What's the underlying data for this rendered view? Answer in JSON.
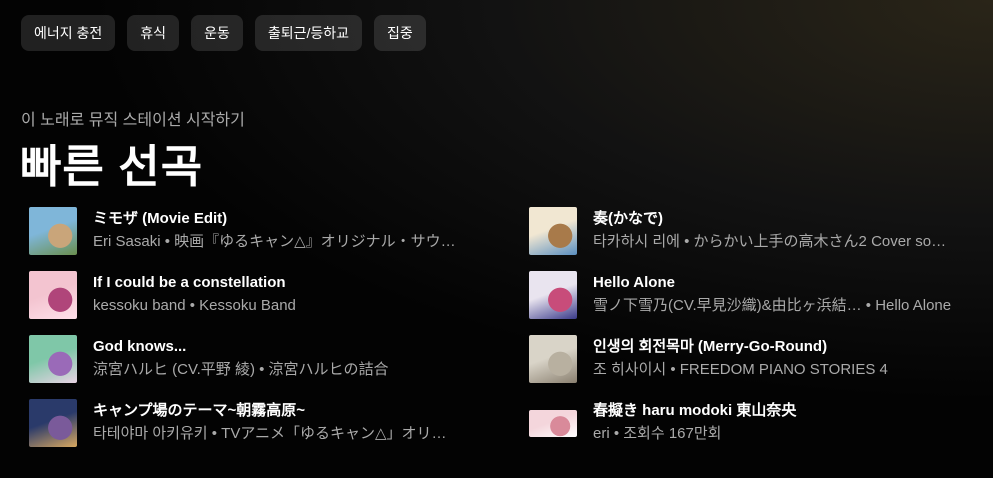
{
  "chips": [
    "에너지 충전",
    "휴식",
    "운동",
    "출퇴근/등하교",
    "집중"
  ],
  "section": {
    "subtitle": "이 노래로 뮤직 스테이션 시작하기",
    "title": "빠른 선곡"
  },
  "left_songs": [
    {
      "title": "ミモザ (Movie Edit)",
      "subtitle": "Eri Sasaki • 映画『ゆるキャン△』オリジナル・サウ…",
      "colors": [
        "#7fb6d9",
        "#c9a57a",
        "#6a8f4e"
      ]
    },
    {
      "title": "If I could be a constellation",
      "subtitle": "kessoku band • Kessoku Band",
      "colors": [
        "#f3c4d0",
        "#b0457a",
        "#ffe0ea"
      ]
    },
    {
      "title": "God knows...",
      "subtitle": "涼宮ハルヒ (CV.平野 綾) • 涼宮ハルヒの詰合",
      "colors": [
        "#7fc7a8",
        "#9a6ab8",
        "#e8d3e4"
      ]
    },
    {
      "title": "キャンプ場のテーマ~朝霧高原~",
      "subtitle": "타테야마 아키유키 • TVアニメ「ゆるキャン△」オリ…",
      "colors": [
        "#2a3a6a",
        "#7a5a9a",
        "#d8a860"
      ]
    }
  ],
  "right_songs": [
    {
      "title": "奏(かなで)",
      "subtitle": "타카하시 리에 • からかい上手の高木さん2 Cover so…",
      "colors": [
        "#f1e7d2",
        "#a87a4a",
        "#5a8fc0"
      ]
    },
    {
      "title": "Hello Alone",
      "subtitle": "雪ノ下雪乃(CV.早見沙織)&由比ヶ浜結…  • Hello Alone",
      "colors": [
        "#e9e4ef",
        "#c84c7a",
        "#3a3a8a"
      ]
    },
    {
      "title": "인생의 회전목마 (Merry-Go-Round)",
      "subtitle": "조 히사이시 • FREEDOM PIANO STORIES 4",
      "colors": [
        "#d9d4c8",
        "#b8b0a0",
        "#8a8070"
      ]
    },
    {
      "title": "春擬き haru modoki 東山奈央",
      "subtitle": "eri • 조회수 167만회",
      "colors": [
        "#f4d6dc",
        "#d98a9a",
        "#ffffff"
      ]
    }
  ]
}
